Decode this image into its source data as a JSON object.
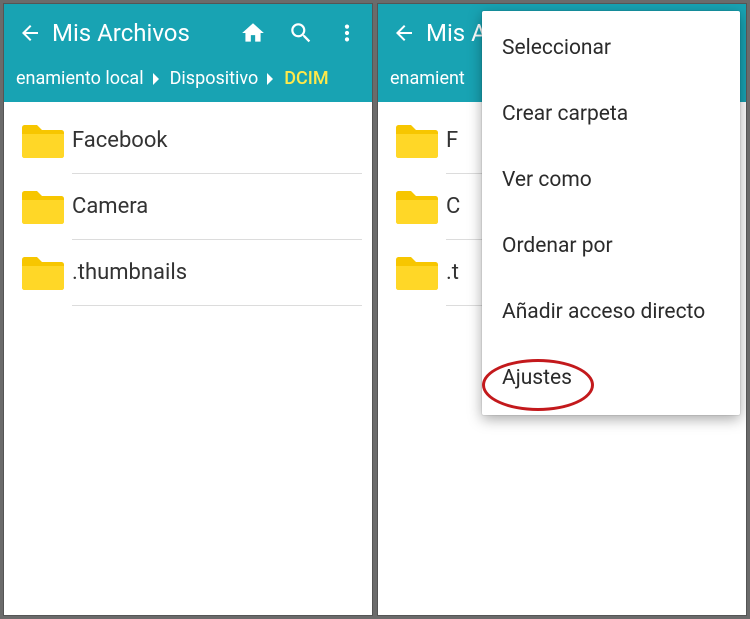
{
  "appbar": {
    "title": "Mis Archivos"
  },
  "breadcrumbs": {
    "items": [
      "enamiento local",
      "Dispositivo",
      "DCIM"
    ]
  },
  "folders": [
    {
      "name": "Facebook"
    },
    {
      "name": "Camera"
    },
    {
      "name": ".thumbnails"
    }
  ],
  "menu": {
    "items": [
      "Seleccionar",
      "Crear carpeta",
      "Ver como",
      "Ordenar por",
      "Añadir acceso directo",
      "Ajustes"
    ],
    "highlighted_index": 5
  },
  "right_screen": {
    "title_visible": "Mis A",
    "breadcrumb_visible": "enamient",
    "folder_labels_visible": [
      "F",
      "C",
      ".t"
    ]
  }
}
